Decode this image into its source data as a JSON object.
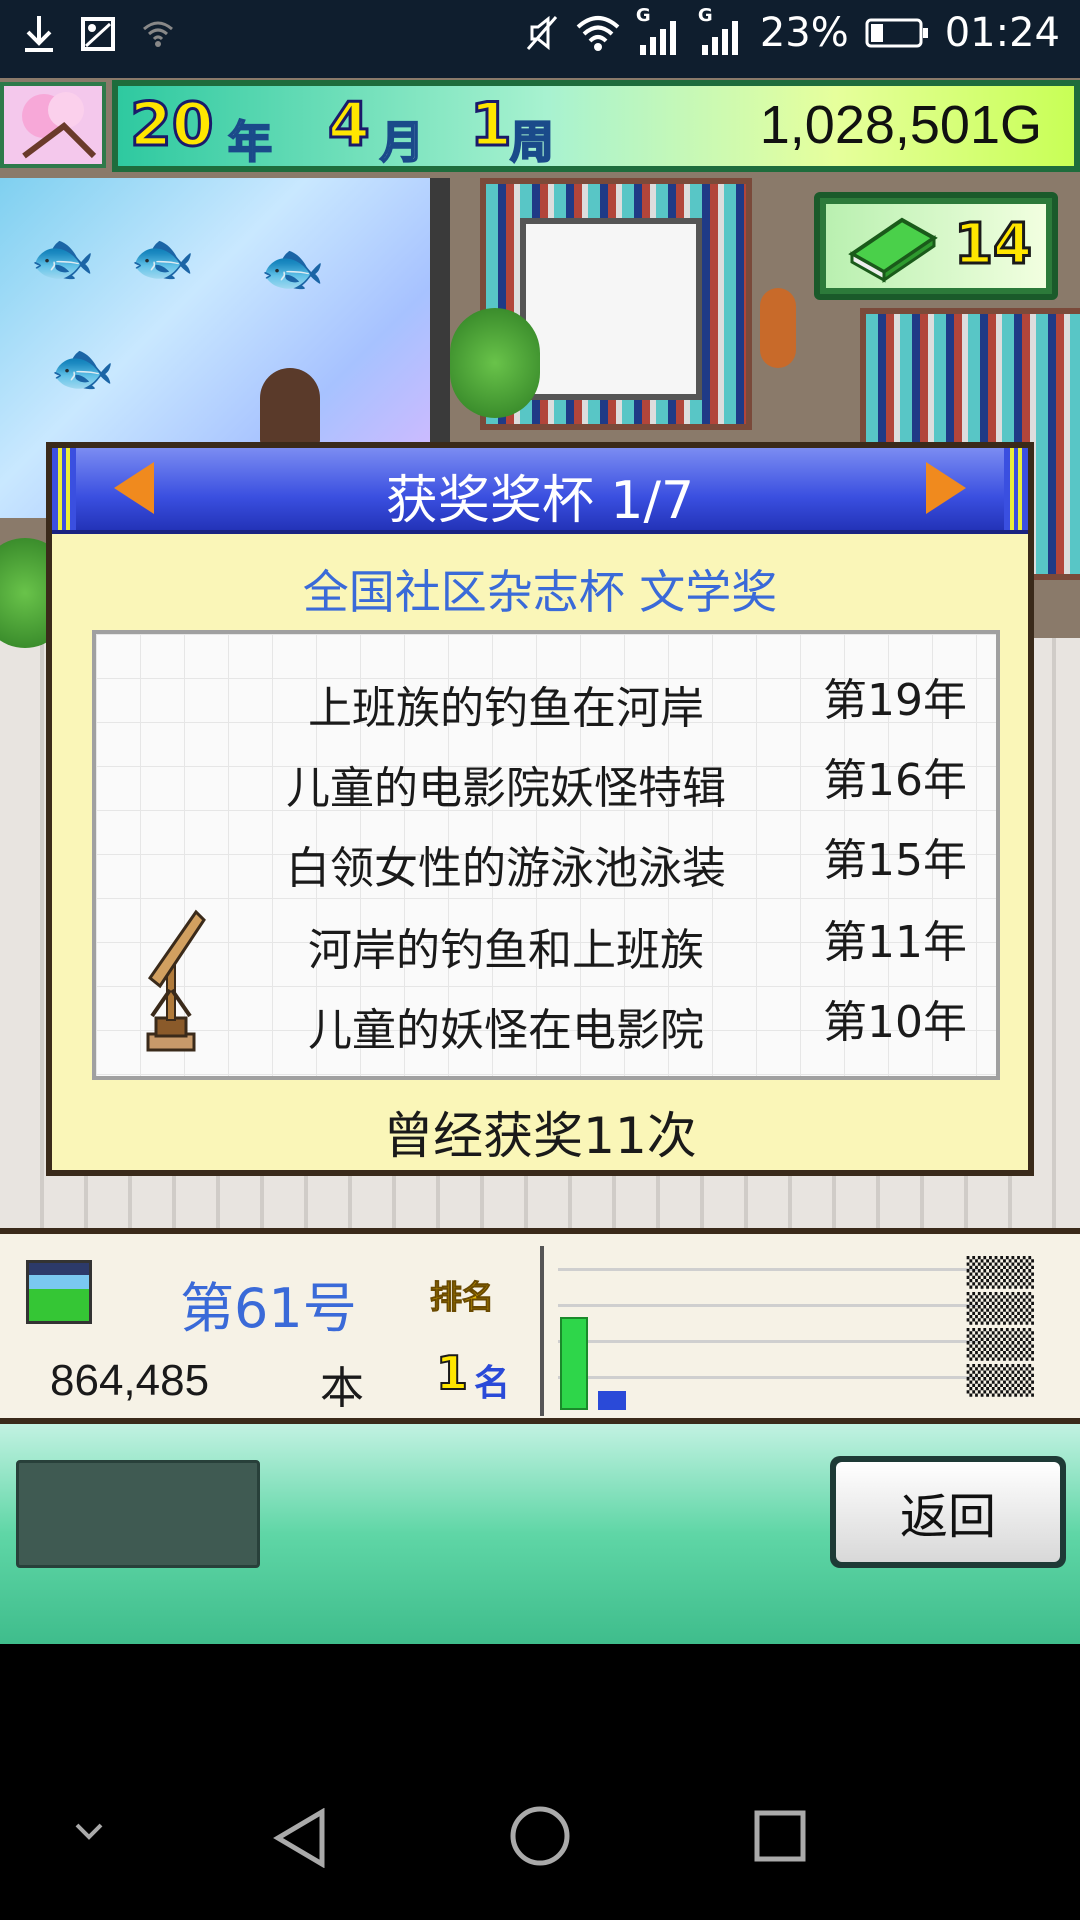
{
  "status_bar": {
    "battery": "23%",
    "time": "01:24",
    "signal_1": "G",
    "signal_2": "G",
    "icons": [
      "download-icon",
      "image-icon",
      "wifi-question-icon",
      "mute-icon",
      "wifi-icon",
      "signal-icon",
      "battery-icon"
    ]
  },
  "header": {
    "year_num": "20",
    "year_unit": "年",
    "month_num": "4",
    "month_unit": "月",
    "week_num": "1",
    "week_unit": "周",
    "money": "1,028,501G",
    "books": "14"
  },
  "dialog": {
    "title": "获奖奖杯 1/7",
    "award_name": "全国社区杂志杯 文学奖",
    "awards": [
      {
        "title": "上班族的钓鱼在河岸",
        "year": "第19年"
      },
      {
        "title": "儿童的电影院妖怪特辑",
        "year": "第16年"
      },
      {
        "title": "白领女性的游泳池泳装",
        "year": "第15年"
      },
      {
        "title": "河岸的钓鱼和上班族",
        "year": "第11年"
      },
      {
        "title": "儿童的妖怪在电影院",
        "year": "第10年"
      }
    ],
    "total": "曾经获奖11次"
  },
  "info": {
    "issue": "第61号",
    "rank_label": "排名",
    "sales": "864,485",
    "sales_unit": "本",
    "rank_value": "1",
    "rank_unit": "名",
    "bar_levels": [
      0.58,
      0.12
    ]
  },
  "buttons": {
    "back": "返回"
  },
  "colors": {
    "dialog_header": "#3a4fe0",
    "award_name": "#3a6ad8",
    "money_bar": "#a8f2d0",
    "arrow": "#f08a1e"
  }
}
